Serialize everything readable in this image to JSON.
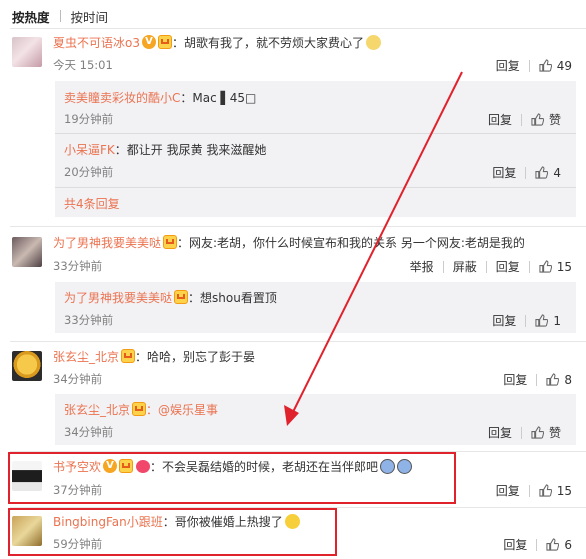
{
  "tabs": [
    {
      "label": "按热度"
    },
    {
      "label": "按时间"
    }
  ],
  "comments": [
    {
      "user": "夏虫不可语冰o3",
      "text": "：胡歌有我了，就不劳烦大家费心了",
      "time": "今天 15:01",
      "reply_label": "回复",
      "likes": "49",
      "replies": [
        {
          "user": "卖美瞳卖彩妆的酷小C",
          "text": "：Mac ▌45□",
          "time": "19分钟前",
          "reply_label": "回复",
          "like_label": "赞"
        },
        {
          "user": "小呆逼FK",
          "text": "：都让开 我尿黄 我来滋醒她",
          "time": "20分钟前",
          "reply_label": "回复",
          "likes": "4"
        }
      ],
      "more_replies": "共4条回复"
    },
    {
      "user": "为了男神我要美美哒",
      "text": "：网友:老胡，你什么时候宣布和我的关系 另一个网友:老胡是我的",
      "time": "33分钟前",
      "report_label": "举报",
      "block_label": "屏蔽",
      "reply_label": "回复",
      "likes": "15",
      "replies": [
        {
          "user": "为了男神我要美美哒",
          "text": "：想shou看置顶",
          "time": "33分钟前",
          "reply_label": "回复",
          "likes": "1"
        }
      ]
    },
    {
      "user": "张玄尘_北京",
      "text": "：哈哈，别忘了彭于晏",
      "time": "34分钟前",
      "reply_label": "回复",
      "likes": "8",
      "replies": [
        {
          "user": "张玄尘_北京",
          "text": "：@娱乐星事",
          "time": "34分钟前",
          "reply_label": "回复",
          "like_label": "赞"
        }
      ]
    },
    {
      "user": "书予空欢",
      "text": "：不会吴磊结婚的时候，老胡还在当伴郎吧",
      "time": "37分钟前",
      "reply_label": "回复",
      "likes": "15"
    },
    {
      "user": "BingbingFan小跟班",
      "text": "：哥你被催婚上热搜了",
      "time": "59分钟前",
      "reply_label": "回复",
      "likes": "6"
    }
  ],
  "colors": {
    "username": "#eb7350",
    "highlight_box": "#e0222d",
    "arrow": "#e0222d",
    "reply_bg": "#f2f2f5"
  }
}
